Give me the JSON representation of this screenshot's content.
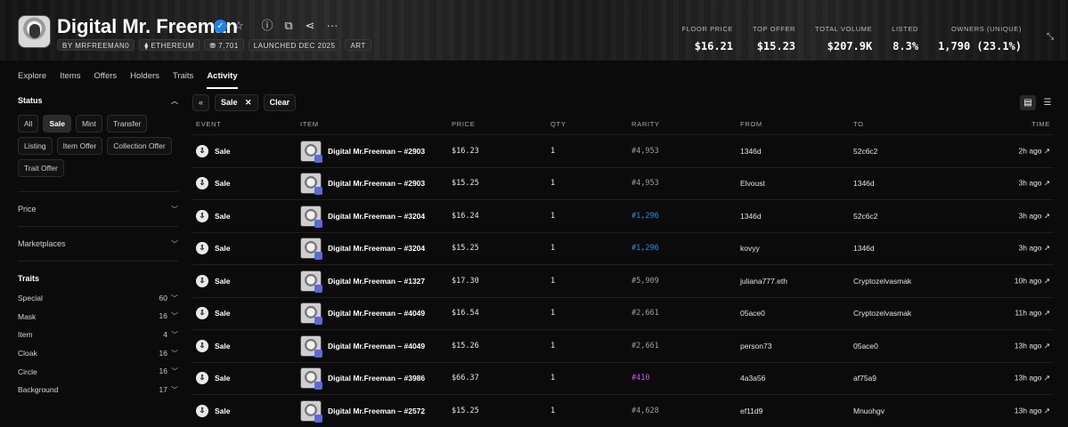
{
  "collection": {
    "name": "Digital Mr. Freeman",
    "chips": [
      "BY MRFREEMAN0",
      "⧫ ETHEREUM",
      "⛃ 7,701",
      "LAUNCHED DEC 2025",
      "ART"
    ]
  },
  "stats": [
    {
      "label": "FLOOR PRICE",
      "value": "$16.21"
    },
    {
      "label": "TOP OFFER",
      "value": "$15.23"
    },
    {
      "label": "TOTAL VOLUME",
      "value": "$207.9K"
    },
    {
      "label": "LISTED",
      "value": "8.3%"
    },
    {
      "label": "OWNERS (UNIQUE)",
      "value": "1,790 (23.1%)"
    }
  ],
  "tabs": [
    "Explore",
    "Items",
    "Offers",
    "Holders",
    "Traits",
    "Activity"
  ],
  "sidebar": {
    "status_title": "Status",
    "status_buttons": [
      "All",
      "Sale",
      "Mint",
      "Transfer",
      "Listing",
      "Item Offer",
      "Collection Offer",
      "Trait Offer"
    ],
    "price_title": "Price",
    "marketplaces_title": "Marketplaces",
    "traits_title": "Traits",
    "traits": [
      {
        "name": "Special",
        "count": "60"
      },
      {
        "name": "Mask",
        "count": "16"
      },
      {
        "name": "Item",
        "count": "4"
      },
      {
        "name": "Cloak",
        "count": "16"
      },
      {
        "name": "Circle",
        "count": "16"
      },
      {
        "name": "Background",
        "count": "17"
      }
    ]
  },
  "toolbar": {
    "collapse_icon": "«",
    "filter_chip": "Sale",
    "clear_label": "Clear"
  },
  "table": {
    "headers": [
      "EVENT",
      "ITEM",
      "PRICE",
      "QTY",
      "RARITY",
      "FROM",
      "TO",
      "TIME"
    ],
    "rows": [
      {
        "event": "Sale",
        "item": "Digital Mr.Freeman – #2903",
        "price": "$16.23",
        "qty": "1",
        "rarity": "#4,953",
        "rarity_color": "#9d9d9d",
        "from": "1346d",
        "to": "52c6c2",
        "time": "2h ago ↗"
      },
      {
        "event": "Sale",
        "item": "Digital Mr.Freeman – #2903",
        "price": "$15.25",
        "qty": "1",
        "rarity": "#4,953",
        "rarity_color": "#9d9d9d",
        "from": "Elvoust",
        "to": "1346d",
        "time": "3h ago ↗"
      },
      {
        "event": "Sale",
        "item": "Digital Mr.Freeman – #3204",
        "price": "$16.24",
        "qty": "1",
        "rarity": "#1,296",
        "rarity_color": "#2f8fe8",
        "from": "1346d",
        "to": "52c6c2",
        "time": "3h ago ↗"
      },
      {
        "event": "Sale",
        "item": "Digital Mr.Freeman – #3204",
        "price": "$15.25",
        "qty": "1",
        "rarity": "#1,296",
        "rarity_color": "#2f8fe8",
        "from": "kovyy",
        "to": "1346d",
        "time": "3h ago ↗"
      },
      {
        "event": "Sale",
        "item": "Digital Mr.Freeman – #1327",
        "price": "$17.30",
        "qty": "1",
        "rarity": "#5,909",
        "rarity_color": "#9d9d9d",
        "from": "juliana777.eth",
        "to": "Cryptozelvasmak",
        "time": "10h ago ↗"
      },
      {
        "event": "Sale",
        "item": "Digital Mr.Freeman – #4049",
        "price": "$16.54",
        "qty": "1",
        "rarity": "#2,661",
        "rarity_color": "#9d9d9d",
        "from": "05ace0",
        "to": "Cryptozelvasmak",
        "time": "11h ago ↗"
      },
      {
        "event": "Sale",
        "item": "Digital Mr.Freeman – #4049",
        "price": "$15.26",
        "qty": "1",
        "rarity": "#2,661",
        "rarity_color": "#9d9d9d",
        "from": "person73",
        "to": "05ace0",
        "time": "13h ago ↗"
      },
      {
        "event": "Sale",
        "item": "Digital Mr.Freeman – #3986",
        "price": "$66.37",
        "qty": "1",
        "rarity": "#410",
        "rarity_color": "#c454e6",
        "from": "4a3a56",
        "to": "af75a9",
        "time": "13h ago ↗"
      },
      {
        "event": "Sale",
        "item": "Digital Mr.Freeman – #2572",
        "price": "$15.25",
        "qty": "1",
        "rarity": "#4,628",
        "rarity_color": "#9d9d9d",
        "from": "ef11d9",
        "to": "Mnuohgv",
        "time": "13h ago ↗"
      }
    ]
  },
  "icons": {
    "verified": "verified-badge-icon",
    "star": "star-icon",
    "info": "info-icon",
    "copy": "copy-icon",
    "share": "share-icon",
    "more": "more-icon",
    "event": "sale-event-icon"
  }
}
